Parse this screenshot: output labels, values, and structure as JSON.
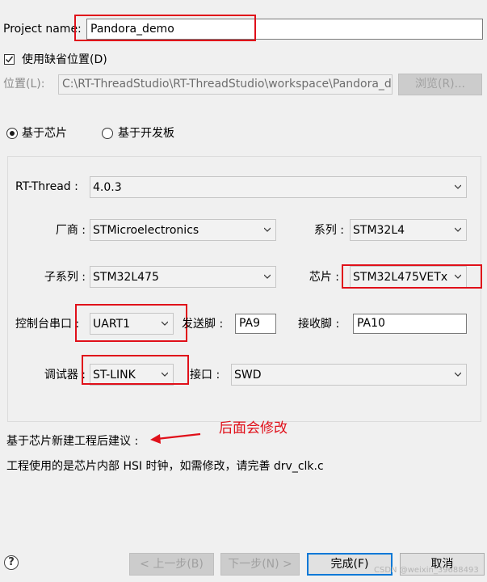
{
  "project": {
    "label": "Project name:",
    "value": "Pandora_demo"
  },
  "use_default_location": {
    "label": "使用缺省位置(D)",
    "checked": true
  },
  "location": {
    "label": "位置(L):",
    "value": "C:\\RT-ThreadStudio\\RT-ThreadStudio\\workspace\\Pandora_demo",
    "browse_label": "浏览(R)..."
  },
  "mode": {
    "chip_label": "基于芯片",
    "board_label": "基于开发板",
    "selected": "chip"
  },
  "fields": {
    "rtthread": {
      "label": "RT-Thread :",
      "value": "4.0.3"
    },
    "vendor": {
      "label": "厂商 :",
      "value": "STMicroelectronics"
    },
    "series": {
      "label": "系列 :",
      "value": "STM32L4"
    },
    "subseries": {
      "label": "子系列 :",
      "value": "STM32L475"
    },
    "chip": {
      "label": "芯片 :",
      "value": "STM32L475VETx"
    },
    "console_uart": {
      "label": "控制台串口 :",
      "value": "UART1"
    },
    "tx_pin": {
      "label": "发送脚 :",
      "value": "PA9"
    },
    "rx_pin": {
      "label": "接收脚 :",
      "value": "PA10"
    },
    "debugger": {
      "label": "调试器 :",
      "value": "ST-LINK"
    },
    "interface": {
      "label": "接口 :",
      "value": "SWD"
    }
  },
  "advice": {
    "title": "基于芯片新建工程后建议 :",
    "annotation": "后面会修改",
    "message": "工程使用的是芯片内部 HSI 时钟，如需修改，请完善 drv_clk.c"
  },
  "buttons": {
    "back": "< 上一步(B)",
    "next": "下一步(N) >",
    "finish": "完成(F)",
    "cancel": "取消"
  },
  "watermark": "CSDN @weixin_39688493",
  "colors": {
    "annotation_red": "#e0101a",
    "focus_blue": "#0078d7"
  }
}
